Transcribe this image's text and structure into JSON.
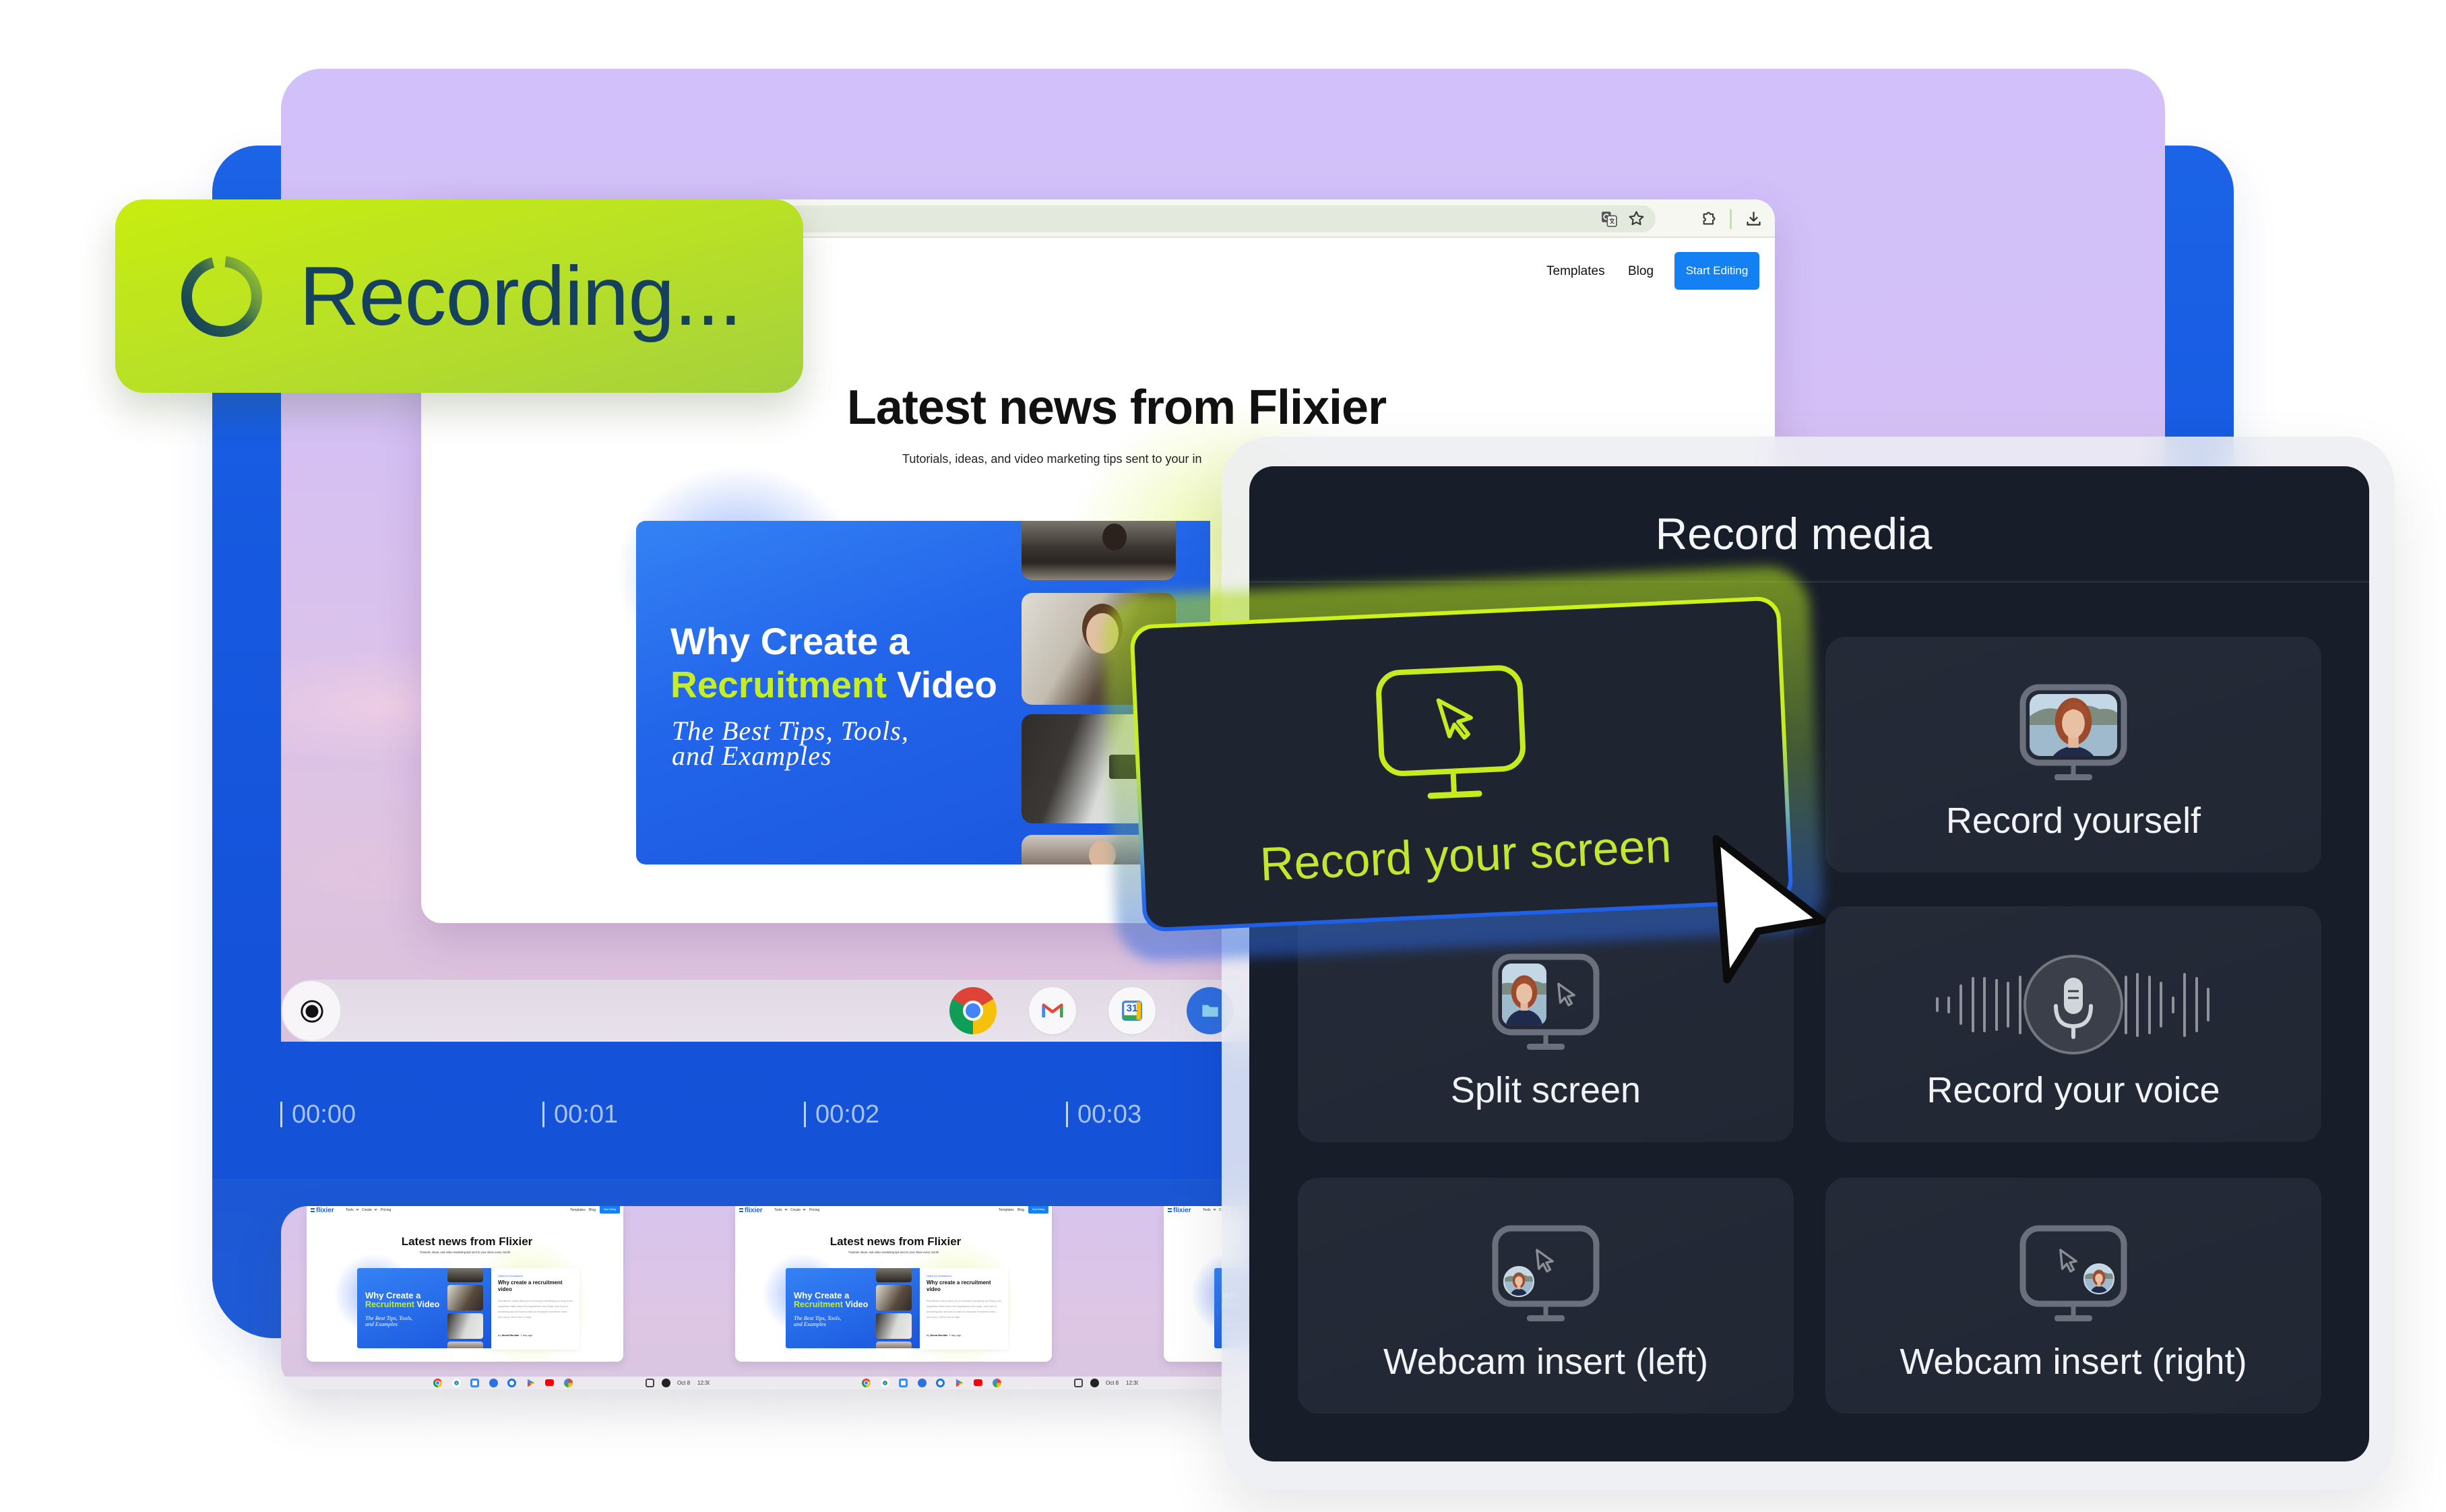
{
  "theme": {
    "lime": "#c6ec1f",
    "brand_blue": "#1a60e6",
    "panel_bg": "#171d29",
    "option_bg": "#222835",
    "desktop_purple": "#d1c0fa",
    "cta_blue": "#1380f3",
    "recording_text": "#15405e",
    "highlight_text": "#c3e72d"
  },
  "recording_badge": {
    "label": "Recording...",
    "icon": "loading-spinner-icon"
  },
  "browser": {
    "toolbar_icons": [
      "translate-icon",
      "bookmark-star-icon",
      "extensions-icon",
      "download-icon"
    ],
    "nav": {
      "templates": "Templates",
      "blog": "Blog",
      "cta": "Start Editing"
    },
    "page": {
      "heading": "Latest news from Flixier",
      "subtitle": "Tutorials, ideas, and video marketing tips sent to your in"
    },
    "featured_post": {
      "line1": "Why Create a",
      "highlight": "Recruitment",
      "line2_rest": " Video",
      "script_line1": "The Best Tips, Tools,",
      "script_line2": "and Examples"
    }
  },
  "taskbar": {
    "apps": [
      "Chrome",
      "Gmail",
      "Calendar",
      "Files"
    ],
    "calendar_day": "31"
  },
  "timeline": {
    "marks": [
      "00:00",
      "00:01",
      "00:02",
      "00:03"
    ]
  },
  "thumbnails": {
    "count": 3,
    "frame": {
      "logo": "flixier",
      "nav": [
        "Tools",
        "Create",
        "Pricing"
      ],
      "right_nav": [
        "Templates",
        "Blog"
      ],
      "cta": "Start Editing",
      "heading": "Latest news from Flixier",
      "subtitle": "Tutorials, ideas, and video marketing tips sent to your inbox every month",
      "post_line1": "Why Create a",
      "post_highlight": "Recruitment",
      "post_rest": " Video",
      "post_script1": "The Best Tips, Tools,",
      "post_script2": "and Examples",
      "article_tag": "Video for recruitment",
      "article_title": "Why create a recruitment video",
      "article_excerpt": "Recruitment videos allow you to showcase everything you bring to the negotiation table before the negotiations even begin. And if you're wondering why and how to make an employee recruitment video, don't worry. We're here to help!",
      "by_label": "by",
      "article_author": "Alexa Nicolae",
      "article_time": "1 day ago",
      "date": "Oct 8",
      "time": "12:30"
    }
  },
  "record_media": {
    "title": "Record media",
    "options": [
      {
        "label": "Record your screen",
        "icon": "screen-cursor-icon",
        "selected": true
      },
      {
        "label": "Record yourself",
        "icon": "webcam-monitor-icon",
        "selected": false
      },
      {
        "label": "Split screen",
        "icon": "split-screen-icon",
        "selected": false
      },
      {
        "label": "Record your voice",
        "icon": "microphone-icon",
        "selected": false
      },
      {
        "label": "Webcam insert (left)",
        "icon": "webcam-left-icon",
        "selected": false
      },
      {
        "label": "Webcam insert (right)",
        "icon": "webcam-right-icon",
        "selected": false
      }
    ]
  }
}
